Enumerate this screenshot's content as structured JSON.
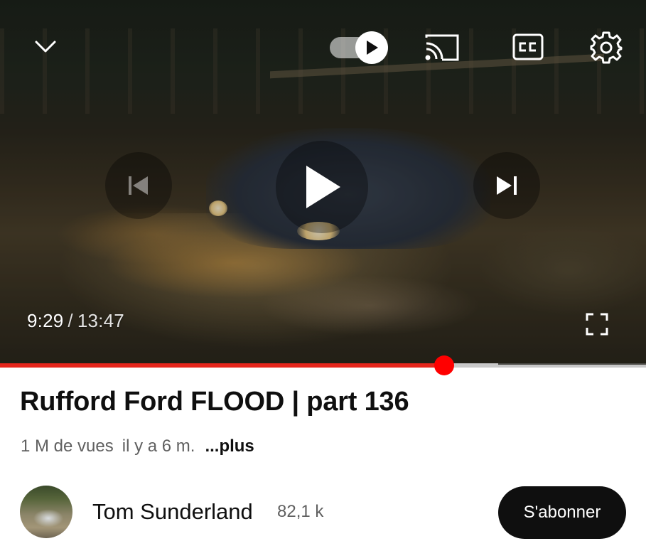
{
  "player": {
    "current_time": "9:29",
    "separator": "/",
    "duration": "13:47",
    "progress_played": 0.688,
    "progress_buffered": 0.771,
    "autoplay_on": true,
    "accent_color": "#ff0000",
    "icons": {
      "collapse": "chevron-down-icon",
      "autoplay": "autoplay-toggle-icon",
      "cast": "cast-icon",
      "captions": "closed-captions-icon",
      "settings": "gear-icon",
      "previous": "skip-previous-icon",
      "play": "play-icon",
      "next": "skip-next-icon",
      "fullscreen": "fullscreen-icon"
    }
  },
  "video": {
    "title": "Rufford Ford FLOOD | part 136",
    "views": "1 M de vues",
    "uploaded": "il y a 6 m.",
    "more_label": "...plus"
  },
  "channel": {
    "name": "Tom Sunderland",
    "subscribers": "82,1 k",
    "subscribe_label": "S'abonner"
  }
}
